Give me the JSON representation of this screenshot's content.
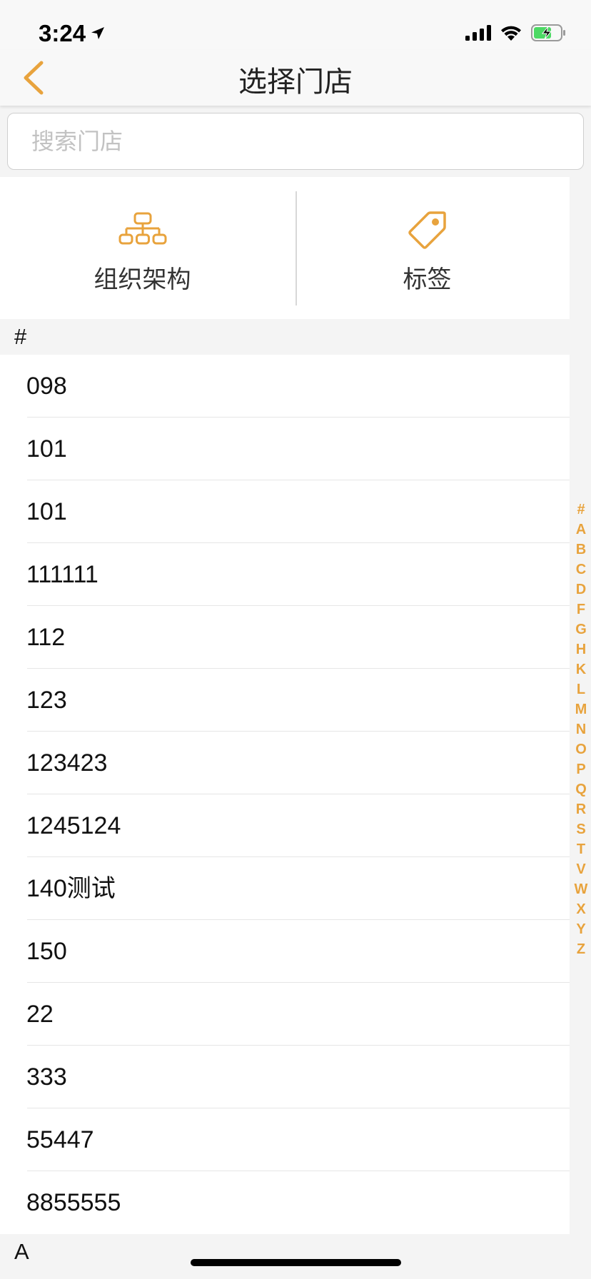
{
  "status_bar": {
    "time": "3:24"
  },
  "nav": {
    "title": "选择门店"
  },
  "search": {
    "placeholder": "搜索门店",
    "value": ""
  },
  "filters": {
    "org_label": "组织架构",
    "tag_label": "标签"
  },
  "sections": {
    "hash_header": "#",
    "a_header": "A"
  },
  "stores": [
    "098",
    "101",
    "101",
    "111111",
    "112",
    "123",
    "123423",
    "1245124",
    "140测试",
    "150",
    "22",
    "333",
    "55447",
    "8855555"
  ],
  "index_letters": [
    "#",
    "A",
    "B",
    "C",
    "D",
    "F",
    "G",
    "H",
    "K",
    "L",
    "M",
    "N",
    "O",
    "P",
    "Q",
    "R",
    "S",
    "T",
    "V",
    "W",
    "X",
    "Y",
    "Z"
  ],
  "colors": {
    "accent": "#e8a33d",
    "battery_fill": "#4cd964"
  }
}
